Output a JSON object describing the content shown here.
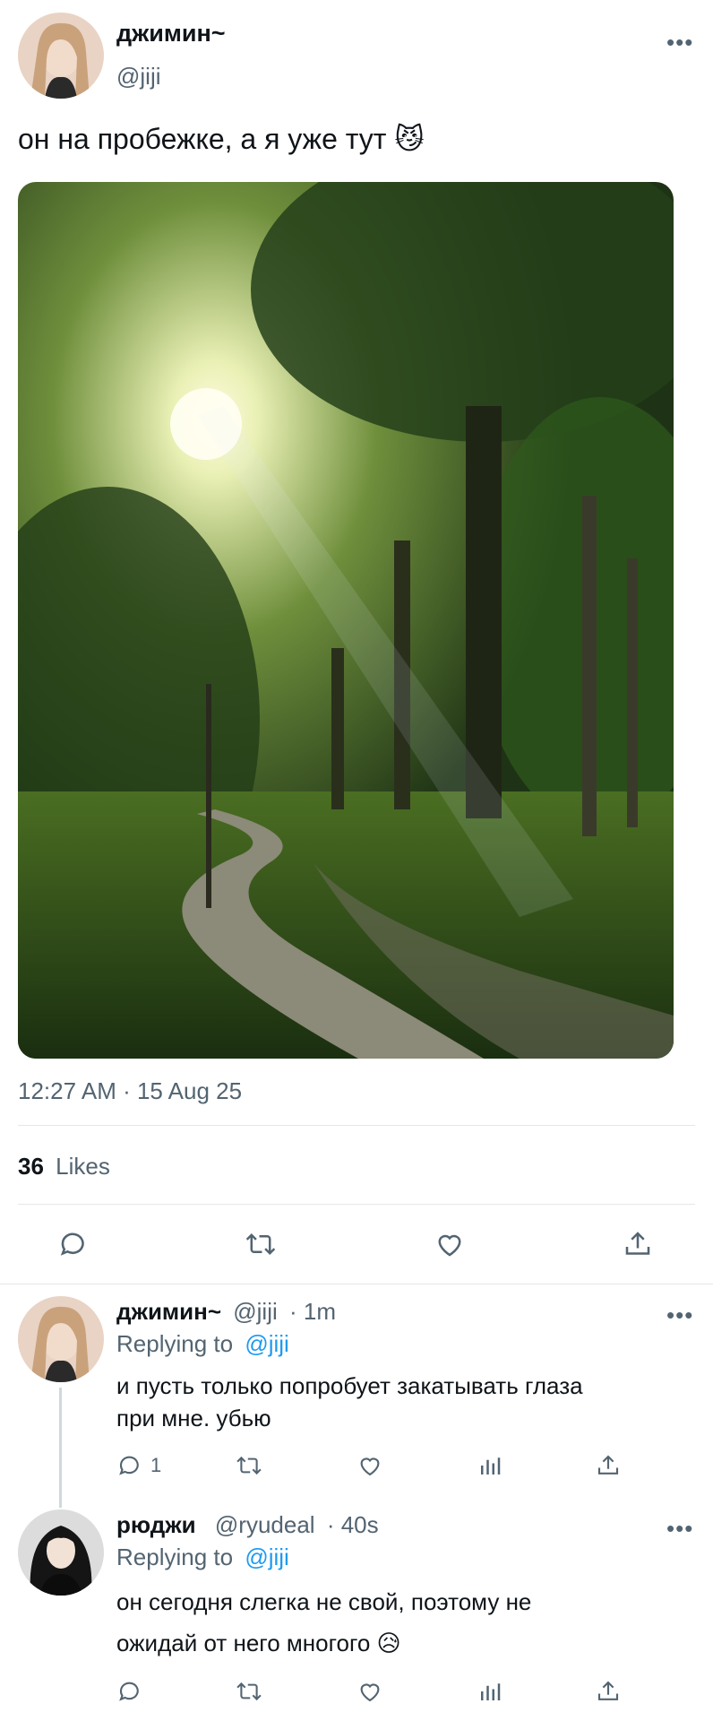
{
  "tweet": {
    "author_name": "джимин~",
    "author_handle": "@jiji",
    "text": "он на пробежке, а я уже тут 😼",
    "timestamp": "12:27 AM · 15 Aug 25",
    "likes_count": "36",
    "likes_label": "Likes",
    "icons": [
      "reply-icon",
      "retweet-icon",
      "like-icon",
      "share-icon"
    ]
  },
  "replies": [
    {
      "name": "джимин~",
      "handle": "@jiji",
      "time": "· 1m",
      "replying_prefix": "Replying to",
      "replying_to": "@jiji",
      "text_line1": "и пусть только попробует закатывать глаза",
      "text_line2": "при мне. убью",
      "reply_count": "1"
    },
    {
      "name": "рюджи",
      "handle": "@ryudeal",
      "time": "· 40s",
      "replying_prefix": "Replying to",
      "replying_to": "@jiji",
      "text_line1": "он сегодня слегка не свой, поэтому не",
      "text_line2": "ожидай от него многого 😥",
      "reply_count": ""
    }
  ],
  "colors": {
    "link": "#1d9bf0",
    "muted": "#536471",
    "divider": "#e6e6e6"
  }
}
